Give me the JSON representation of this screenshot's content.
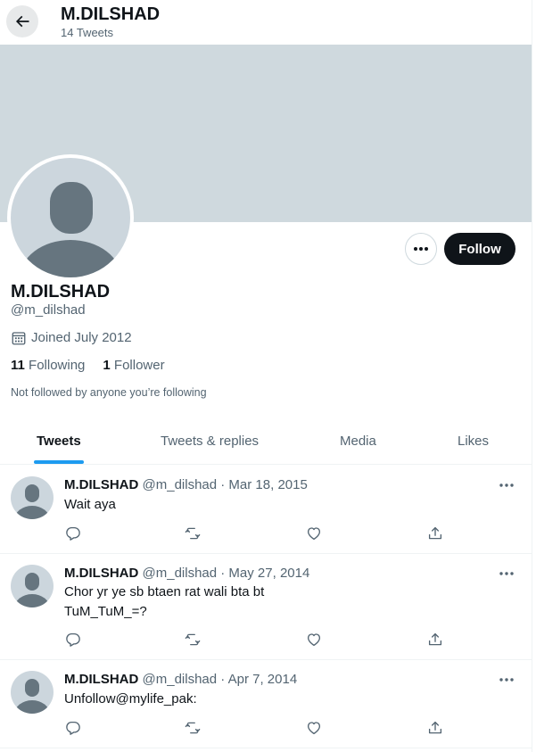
{
  "header": {
    "title": "M.DILSHAD",
    "tweet_count": "14 Tweets"
  },
  "profile": {
    "name": "M.DILSHAD",
    "handle": "@m_dilshad",
    "joined": "Joined July 2012",
    "following_count": "11",
    "following_label": "Following",
    "followers_count": "1",
    "followers_label": "Follower",
    "not_followed": "Not followed by anyone you’re following",
    "follow_label": "Follow"
  },
  "tabs": [
    {
      "label": "Tweets",
      "active": true
    },
    {
      "label": "Tweets & replies",
      "active": false
    },
    {
      "label": "Media",
      "active": false
    },
    {
      "label": "Likes",
      "active": false
    }
  ],
  "tweets": [
    {
      "name": "M.DILSHAD",
      "meta": "@m_dilshad · Mar 18, 2015",
      "text_lines": [
        "Wait aya"
      ]
    },
    {
      "name": "M.DILSHAD",
      "meta": "@m_dilshad · May 27, 2014",
      "text_lines": [
        "Chor yr ye sb btaen rat wali bta bt",
        "TuM_TuM_=?"
      ]
    },
    {
      "name": "M.DILSHAD",
      "meta": "@m_dilshad · Apr 7, 2014",
      "text_lines": [
        "Unfollow@mylife_pak:"
      ]
    }
  ],
  "icons": {
    "back": "arrow-left-icon",
    "more": "more-horizontal-icon",
    "calendar": "calendar-icon",
    "reply": "reply-icon",
    "retweet": "retweet-icon",
    "like": "heart-icon",
    "share": "share-icon"
  },
  "colors": {
    "banner": "#cfd9de",
    "avatar_bg": "#ccd6dd",
    "avatar_figure": "#66757f",
    "accent": "#1d9bf0",
    "follow_button": "#0f1419",
    "secondary_text": "#536471"
  }
}
